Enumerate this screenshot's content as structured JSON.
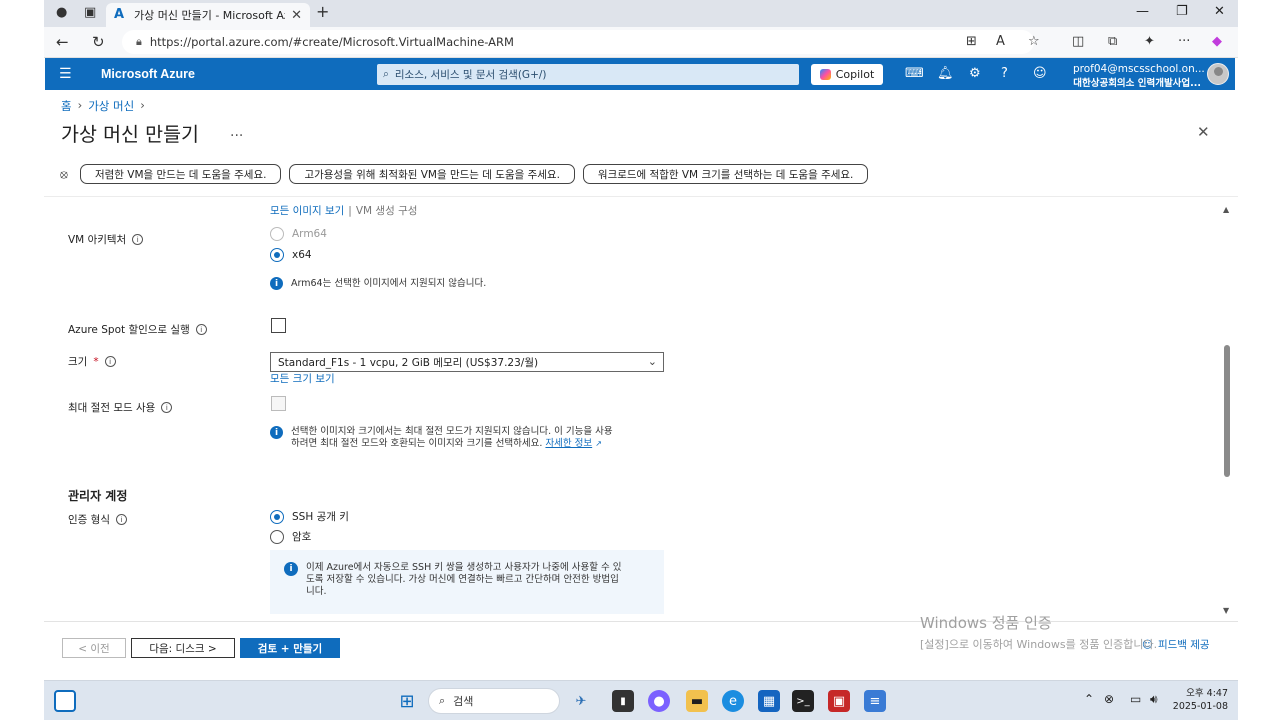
{
  "browser": {
    "tab_title": "가상 머신 만들기 - Microsoft Azure",
    "url": "https://portal.azure.com/#create/Microsoft.VirtualMachine-ARM"
  },
  "azure_header": {
    "brand": "Microsoft Azure",
    "search_placeholder": "리소스, 서비스 및 문서 검색(G+/)",
    "copilot_label": "Copilot",
    "user_email": "prof04@mscsschool.on...",
    "user_org": "대한상공회의소 인력개발사업..."
  },
  "breadcrumb": {
    "home": "홈",
    "vm": "가상 머신"
  },
  "page": {
    "title": "가상 머신 만들기",
    "more": "..."
  },
  "helpers": [
    "저렴한 VM을 만드는 데 도움을 주세요.",
    "고가용성을 위해 최적화된 VM을 만드는 데 도움을 주세요.",
    "워크로드에 적합한 VM 크기를 선택하는 데 도움을 주세요."
  ],
  "form": {
    "image_links": {
      "all_images": "모든 이미지 보기",
      "sep": "|",
      "vm_config": "VM 생성 구성"
    },
    "vm_arch_label": "VM 아키텍처",
    "arch_options": [
      "Arm64",
      "x64"
    ],
    "arch_note": "Arm64는 선택한 이미지에서 지원되지 않습니다.",
    "spot_label": "Azure Spot 할인으로 실행",
    "size_label": "크기",
    "size_required": "*",
    "size_value": "Standard_F1s - 1 vcpu, 2 GiB 메모리 (US$37.23/월)",
    "all_sizes_link": "모든 크기 보기",
    "hibernate_label": "최대 절전 모드 사용",
    "hibernate_note_1": "선택한 이미지와 크기에서는 최대 절전 모드가 지원되지 않습니다. 이 기능을 사용",
    "hibernate_note_2": "하려면 최대 절전 모드와 호환되는 이미지와 크기를 선택하세요.",
    "learn_more": "자세한 정보",
    "admin_section": "관리자 계정",
    "auth_label": "인증 형식",
    "auth_options": [
      "SSH 공개 키",
      "암호"
    ],
    "ssh_info_1": "이제 Azure에서 자동으로 SSH 키 쌍을 생성하고 사용자가 나중에 사용할 수 있",
    "ssh_info_2": "도록 저장할 수 있습니다. 가상 머신에 연결하는 빠르고 간단하며 안전한 방법입",
    "ssh_info_3": "니다."
  },
  "footer": {
    "prev": "< 이전",
    "next": "다음: 디스크 >",
    "review": "검토 + 만들기",
    "feedback": "피드백 제공"
  },
  "watermark": {
    "line1": "Windows 정품 인증",
    "line2": "[설정]으로 이동하여 Windows를 정품 인증합니다."
  },
  "taskbar": {
    "search": "검색",
    "time": "오후 4:47",
    "date": "2025-01-08"
  },
  "colors": {
    "azure_blue": "#0f6cbd",
    "required_red": "#c50f1f"
  }
}
